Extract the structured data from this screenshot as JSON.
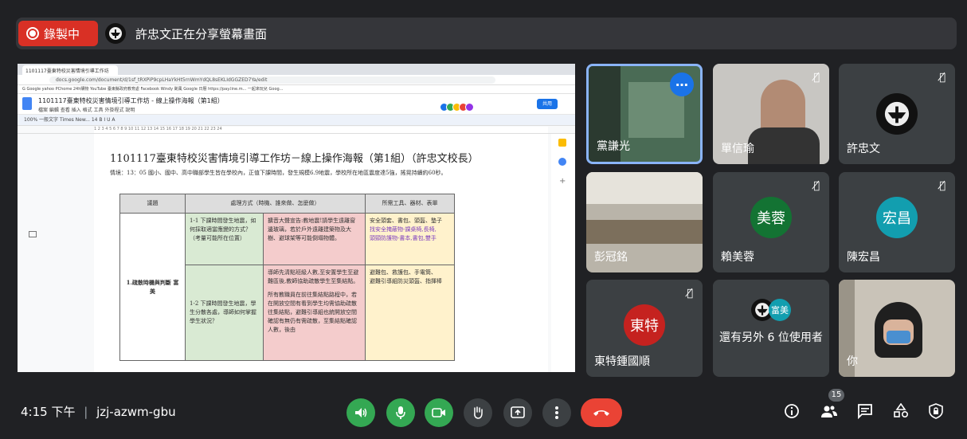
{
  "top_bar": {
    "recording_label": "錄製中",
    "presenter_text": "許忠文正在分享螢幕畫面"
  },
  "shared_screen": {
    "browser": {
      "tab_title": "1101117臺東特校災害情境引導工作坊",
      "address": "docs.google.com/document/d/1sf_tRXPiP9cpLHaYkHt5rnWmYdQL8sEKLIdGGZED7Ya/edit",
      "bookmarks": "G Google   yahoo   PChome 24h購物   YouTube   臺東縣政府教育處   Facebook   Windy 颱風   Google 日曆   https://pay.line.m...   一起來玩兒   Goog..."
    },
    "doc": {
      "title": "1101117臺東特校災害情境引導工作坊 - 線上操作海報（第1組）",
      "menu": "檔案  編輯  查看  插入  格式  工具  外掛程式  說明",
      "share_label": "共用",
      "toolbar": "100%  一般文字  Times New...  14  B  I  U  A",
      "ruler": "1   2   3   4   5   6   7   8   9   10   11   12   13   14   15   16   17   18   19   20   21   22   23   24",
      "heading": "1101117臺東特校災害情境引導工作坊－線上操作海報（第1組）（許忠文校長）",
      "context": "情境：13：05 國小、國中、高中職部學生皆在學校內，正值下課時間，發生規模6.9地震，學校所在地區震度達5強，搖晃持續約60秒。",
      "table": {
        "headers": [
          "議題",
          "處理方式（時機、誰來做、怎麼做）",
          "所需工具、器材、表單"
        ],
        "topic": "1.疏散時機與判斷 富美",
        "rows": [
          {
            "question": "1-1  下課時間發生地震，如何採取適當應變的方式？（考量可能所在位置）",
            "method": "擴音大聲宣告:教地震!請學生遠離窗邊玻璃，若於戶外遠離建築物及大樹、避球架等可能倒塌物體。",
            "tools_a": "安全頭套、書包、頭盔、墊子",
            "tools_b": "找安全掩蔽物-課桌椅,長椅,",
            "tools_c": "頭頸防護物-書本,書包,雙手"
          },
          {
            "question": "1-2  下課時間發生地震，學生分散各處，導師如何掌握學生狀況？",
            "method": "導師先清點班級人數,至安置學生至避難區後,教師協助疏散學生至集結點。",
            "method_b": "所有教職員在前往集結點路程中，若在開放空間有看到學生均需協助疏散往集結點，避難引導組也統開放空間確認有無仍有需疏散，至集結點確認人數，後由",
            "tools_a": "避難包、救護包、手電筒、",
            "tools_b": "避難引導組防災頭盔、指揮棒"
          }
        ]
      }
    }
  },
  "participants": [
    {
      "name": "黨謙光",
      "type": "video"
    },
    {
      "name": "單信瑜",
      "type": "video",
      "muted": true
    },
    {
      "name": "許忠文",
      "type": "avatar",
      "muted": true
    },
    {
      "name": "彭冠銘",
      "type": "video"
    },
    {
      "name": "賴美蓉",
      "type": "initials",
      "initials": "美蓉",
      "color": "#137333",
      "muted": true
    },
    {
      "name": "陳宏昌",
      "type": "initials",
      "initials": "宏昌",
      "color": "#129eaf",
      "muted": true
    },
    {
      "name": "東特鍾國順",
      "type": "initials",
      "initials": "東特",
      "color": "#c5221f",
      "muted": true
    },
    {
      "name": "還有另外 6 位使用者",
      "type": "others",
      "initials": "富美"
    },
    {
      "name": "你",
      "type": "video"
    }
  ],
  "more_options_label": "…",
  "bottom_bar": {
    "time": "4:15 下午",
    "separator": "|",
    "meeting_code": "jzj-azwm-gbu",
    "participant_count": "15"
  },
  "colors": {
    "record": "#d93025",
    "end_call": "#ea4335",
    "controls_on": "#34a853"
  }
}
